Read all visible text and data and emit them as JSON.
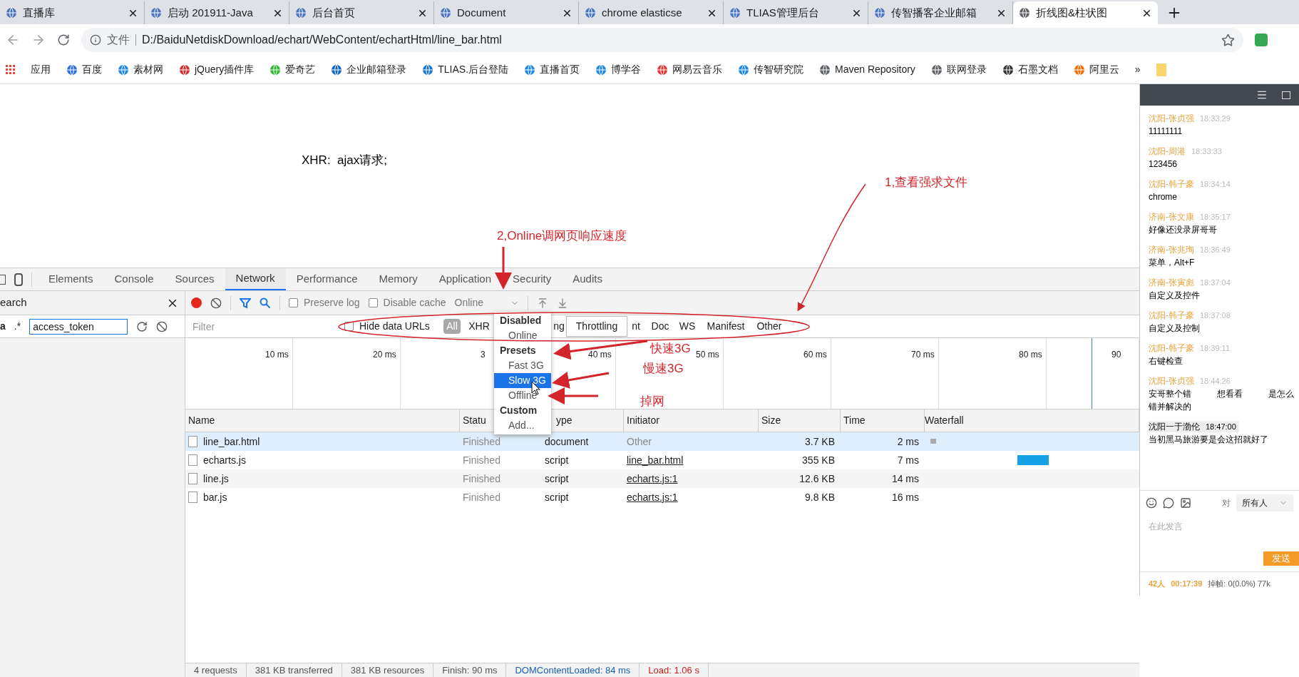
{
  "browser_tabs": [
    {
      "title": "直播库",
      "selected": false
    },
    {
      "title": "启动 201911-Java",
      "selected": false
    },
    {
      "title": "后台首页",
      "selected": false
    },
    {
      "title": "Document",
      "selected": false
    },
    {
      "title": "chrome elasticse",
      "selected": false
    },
    {
      "title": "TLIAS管理后台",
      "selected": false
    },
    {
      "title": "传智播客企业邮箱",
      "selected": false
    },
    {
      "title": "折线图&柱状图",
      "selected": true
    }
  ],
  "address_bar": {
    "scheme_label": "文件",
    "url": "D:/BaiduNetdiskDownload/echart/WebContent/echartHtml/line_bar.html"
  },
  "bookmarks": [
    "应用",
    "百度",
    "素材网",
    "jQuery插件库",
    "爱奇艺",
    "企业邮箱登录",
    "TLIAS.后台登陆",
    "直播首页",
    "博学谷",
    "网易云音乐",
    "传智研究院",
    "Maven Repository",
    "联网登录",
    "石墨文档",
    "阿里云"
  ],
  "bookmarks_more": "»",
  "page": {
    "text": "XHR:  ajax请求;"
  },
  "devtools": {
    "tabs": [
      {
        "label": "Elements",
        "selected": false
      },
      {
        "label": "Console",
        "selected": false
      },
      {
        "label": "Sources",
        "selected": false
      },
      {
        "label": "Network",
        "selected": true
      },
      {
        "label": "Performance",
        "selected": false
      },
      {
        "label": "Memory",
        "selected": false
      },
      {
        "label": "Application",
        "selected": false
      },
      {
        "label": "Security",
        "selected": false
      },
      {
        "label": "Audits",
        "selected": false
      }
    ],
    "search_panel": {
      "title": "earch",
      "case_toggle": "a",
      "regex_toggle": ".*",
      "query": "access_token"
    },
    "toolbar": {
      "recording": true,
      "preserve_log": {
        "label": "Preserve log",
        "checked": false
      },
      "disable_cache": {
        "label": "Disable cache",
        "checked": false
      },
      "throttle": "Online"
    },
    "filter": {
      "placeholder": "Filter",
      "hide_data_urls": {
        "label": "Hide data URLs",
        "checked": false
      },
      "types": [
        {
          "label": "All",
          "selected": true
        },
        {
          "label": "XHR",
          "selected": false
        },
        {
          "label": "ng",
          "selected": false
        },
        {
          "label": "nt",
          "selected": false
        },
        {
          "label": "Doc",
          "selected": false
        },
        {
          "label": "WS",
          "selected": false
        },
        {
          "label": "Manifest",
          "selected": false
        },
        {
          "label": "Other",
          "selected": false
        }
      ]
    },
    "overview_ticks": [
      "10 ms",
      "20 ms",
      "3",
      "40 ms",
      "50 ms",
      "60 ms",
      "70 ms",
      "80 ms",
      "90"
    ],
    "columns": [
      "Name",
      "Statu",
      "ype",
      "Initiator",
      "Size",
      "Time",
      "Waterfall"
    ],
    "rows": [
      {
        "name": "line_bar.html",
        "status": "Finished",
        "type": "document",
        "initiator": "Other",
        "initiator_link": false,
        "size": "3.7 KB",
        "time": "2 ms",
        "selected": true
      },
      {
        "name": "echarts.js",
        "status": "Finished",
        "type": "script",
        "initiator": "line_bar.html",
        "initiator_link": true,
        "size": "355 KB",
        "time": "7 ms",
        "selected": false
      },
      {
        "name": "line.js",
        "status": "Finished",
        "type": "script",
        "initiator": "echarts.js:1",
        "initiator_link": true,
        "size": "12.6 KB",
        "time": "14 ms",
        "selected": false
      },
      {
        "name": "bar.js",
        "status": "Finished",
        "type": "script",
        "initiator": "echarts.js:1",
        "initiator_link": true,
        "size": "9.8 KB",
        "time": "16 ms",
        "selected": false
      }
    ],
    "status_bar": [
      {
        "text": "4 requests",
        "kind": "plain"
      },
      {
        "text": "381 KB transferred",
        "kind": "plain"
      },
      {
        "text": "381 KB resources",
        "kind": "plain"
      },
      {
        "text": "Finish: 90 ms",
        "kind": "plain"
      },
      {
        "text": "DOMContentLoaded: 84 ms",
        "kind": "dom"
      },
      {
        "text": "Load: 1.06 s",
        "kind": "load"
      }
    ],
    "throttle_menu": [
      {
        "label": "Disabled",
        "kind": "header"
      },
      {
        "label": "Online",
        "kind": "option",
        "selected": false
      },
      {
        "label": "Presets",
        "kind": "header"
      },
      {
        "label": "Fast 3G",
        "kind": "option",
        "selected": false
      },
      {
        "label": "Slow 3G",
        "kind": "option",
        "selected": true
      },
      {
        "label": "Offline",
        "kind": "option",
        "selected": false
      },
      {
        "label": "Custom",
        "kind": "header"
      },
      {
        "label": "Add...",
        "kind": "option",
        "selected": false
      }
    ],
    "tooltip": "Throttling"
  },
  "annotations": [
    "2,Online调网页响应速度",
    "1,查看强求文件",
    "快速3G",
    "慢速3G",
    "掉网"
  ],
  "chat": {
    "messages": [
      {
        "name": "沈阳-张贞强",
        "time": "18:33:29",
        "lines": [
          [
            "11111111"
          ]
        ],
        "highlighted": false
      },
      {
        "name": "沈阳-周港",
        "time": "18:33:33",
        "lines": [
          [
            "123456"
          ]
        ],
        "highlighted": false
      },
      {
        "name": "沈阳-韩子豪",
        "time": "18:34:14",
        "lines": [
          [
            "chrome"
          ]
        ],
        "highlighted": false
      },
      {
        "name": "济南-张文康",
        "time": "18:35:17",
        "lines": [
          [
            "好像还没录屏哥哥"
          ]
        ],
        "highlighted": false
      },
      {
        "name": "济南-张兆珣",
        "time": "18:36:49",
        "lines": [
          [
            "菜单，Alt+F"
          ]
        ],
        "highlighted": false
      },
      {
        "name": "济南-张寅彪",
        "time": "18:37:04",
        "lines": [
          [
            "自定义及控件"
          ]
        ],
        "highlighted": false
      },
      {
        "name": "沈阳-韩子豪",
        "time": "18:37:08",
        "lines": [
          [
            "自定义及控制"
          ]
        ],
        "highlighted": false
      },
      {
        "name": "沈阳-韩子豪",
        "time": "18:39:11",
        "lines": [
          [
            "右键检查"
          ]
        ],
        "highlighted": false
      },
      {
        "name": "沈阳-张贞强",
        "time": "18:44:26",
        "lines": [
          [
            "安哥整个错",
            "想看看",
            "是怎么"
          ],
          [
            "错并解决的"
          ]
        ],
        "highlighted": false
      },
      {
        "name": "沈阳一于渤伦",
        "time": "18:47:00",
        "lines": [
          [
            "当初黑马旅游要是会这招就好了"
          ]
        ],
        "highlighted": true
      }
    ],
    "to_label": "对",
    "recipient": "所有人",
    "placeholder": "在此发言",
    "send": "发送",
    "viewers": "42人",
    "elapsed": "00:17:39",
    "dropped": "掉帧: 0(0.0%) 77k"
  }
}
